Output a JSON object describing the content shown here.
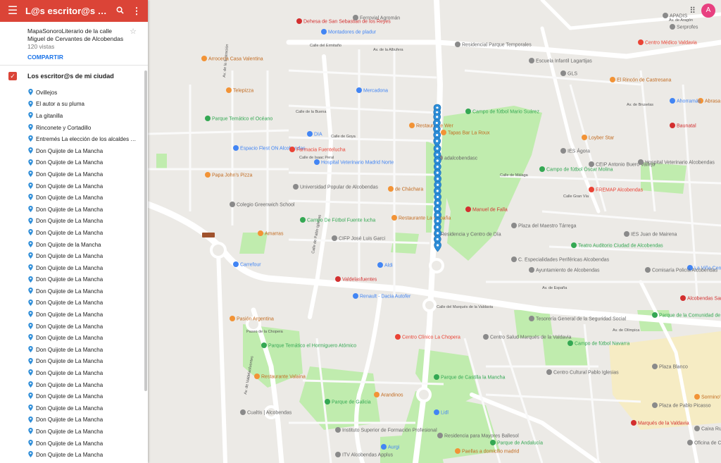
{
  "header": {
    "title": "L@s escritor@s de mi c...",
    "menu_icon": "menu-icon",
    "search_icon": "search-icon",
    "more_icon": "more-vert-icon"
  },
  "map_info": {
    "description": "MapaSonoroLiterario de la calle Miguel de Cervantes de Alcobendas",
    "views": "120 vistas",
    "share_label": "COMPARTIR"
  },
  "layer": {
    "name": "Los escritor@s de mi ciudad",
    "checked": true
  },
  "places": [
    "Ovillejos",
    "El autor a su pluma",
    "La gitanilla",
    "Rinconete y Cortadillo",
    "Entremés La elección de los alcaldes de ...",
    "Don Quijote de La Mancha",
    "Don Quijote de La Mancha",
    "Don Quijote de La Mancha",
    "Don Quijote de La Mancha",
    "Don Quijote de La Mancha",
    "Don Quijote de La Mancha",
    "Don Quijote de La Mancha",
    "Don Quijote de La Mancha",
    "Don Quijote de la Mancha",
    "Don Quijote de La Mancha",
    "Don Quijote de La Mancha",
    "Don Quijote de La Mancha",
    "Don Quijote de La Mancha",
    "Don Quijote de La Mancha",
    "Don Quijote de La Mancha",
    "Don Quijote de La Mancha",
    "Don Quijote de La Mancha",
    "Don Quijote de La Mancha",
    "Don Quijote de La Mancha",
    "Don Quijote de La Mancha",
    "Don Quijote de La Mancha",
    "Don Quijote de La Mancha",
    "Don Quijote de La Mancha",
    "Don Quijote de La Mancha",
    "Don Quijote de La Mancha",
    "Don Quijote de La Mancha",
    "Don Quijote de La Mancha"
  ],
  "account": {
    "avatar_letter": "A",
    "apps_icon": "apps-grid-icon"
  },
  "colors": {
    "header": "#db4437",
    "pin": "#2d8dd8",
    "water": "#aadaff",
    "park": "#c0ecae",
    "hospital": "#ea4335",
    "restaurant": "#f29336",
    "shop": "#4285f4",
    "park_poi": "#34a853",
    "metro": "#d32f2f",
    "pinkpoi": "#e04a82",
    "area": "#f6ecc4"
  },
  "map": {
    "streets": [
      "Av. de la Albufera",
      "Calle del Ermitaño",
      "Av. de la Ilustración",
      "Calle de Isaac Peral",
      "Calle de la Buena",
      "Calle de Goya",
      "Calle de Pablo Iglesias",
      "Calle de Málaga",
      "Av. de España",
      "Av. de Valdelasfuentes",
      "Calle del Marqués de la Valdavia",
      "Paseo de la Chopera",
      "Av. de Olímpica",
      "Av. de Aragón",
      "Calle Gran Vía",
      "Av. de Bruselas"
    ],
    "pois": [
      {
        "name": "Dehesa de San Sebastián de los Reyes",
        "kind": "metro"
      },
      {
        "name": "Ferrovial Agromán",
        "kind": "business"
      },
      {
        "name": "Montadores de pladur",
        "kind": "shop"
      },
      {
        "name": "Residencial Parque Temporales",
        "kind": "business"
      },
      {
        "name": "Arrocería Casa Valentina",
        "kind": "restaurant"
      },
      {
        "name": "Escuela Infantil Lagartijas",
        "kind": "business"
      },
      {
        "name": "GLS",
        "kind": "business"
      },
      {
        "name": "El Rincón de Castresana",
        "kind": "restaurant"
      },
      {
        "name": "Telepizza",
        "kind": "restaurant"
      },
      {
        "name": "Mercadona",
        "kind": "shop"
      },
      {
        "name": "Campo de fútbol Mario Suárez",
        "kind": "park"
      },
      {
        "name": "Parque Temático el Océano",
        "kind": "park"
      },
      {
        "name": "Restaurante Wer",
        "kind": "restaurant"
      },
      {
        "name": "Tapas Bar La Roux",
        "kind": "restaurant"
      },
      {
        "name": "DIA",
        "kind": "shop"
      },
      {
        "name": "Loyber Star",
        "kind": "restaurant"
      },
      {
        "name": "Espacio Flest ON Alcobendas",
        "kind": "shop"
      },
      {
        "name": "Farmacia Fuentelucha",
        "kind": "hospital"
      },
      {
        "name": "adalcobendasc",
        "kind": "business"
      },
      {
        "name": "IES Ágora",
        "kind": "business"
      },
      {
        "name": "Hospital Veterinario Madrid Norte",
        "kind": "shop"
      },
      {
        "name": "Papa John's Pizza",
        "kind": "restaurant"
      },
      {
        "name": "Campo de fútbol Óscar Molina",
        "kind": "park"
      },
      {
        "name": "CEIP Antonio Buero Vallejo",
        "kind": "business"
      },
      {
        "name": "Hospital Veterinario Alcobendas",
        "kind": "business"
      },
      {
        "name": "Universidad Popular de Alcobendas",
        "kind": "business"
      },
      {
        "name": "de Chácharа",
        "kind": "restaurant"
      },
      {
        "name": "FREMAP Alcobendas",
        "kind": "hospital"
      },
      {
        "name": "Colegio Greenwich School",
        "kind": "business"
      },
      {
        "name": "Campo De Fútbol Fuente lucha",
        "kind": "park"
      },
      {
        "name": "Restaurante La Cabaña",
        "kind": "restaurant"
      },
      {
        "name": "Manuel de Falla",
        "kind": "metro"
      },
      {
        "name": "Amarras",
        "kind": "restaurant"
      },
      {
        "name": "CIFP José Luis Garci",
        "kind": "business"
      },
      {
        "name": "Residencia y Centro de Día",
        "kind": "business"
      },
      {
        "name": "Plaza del Maestro Tárrega",
        "kind": "business"
      },
      {
        "name": "Teatro Auditorio Ciudad de Alcobendas",
        "kind": "park"
      },
      {
        "name": "IES Juan de Mairena",
        "kind": "business"
      },
      {
        "name": "Carrefour",
        "kind": "shop"
      },
      {
        "name": "Aldi",
        "kind": "shop"
      },
      {
        "name": "C. Especialidades Periféricas Alcobendas",
        "kind": "business"
      },
      {
        "name": "Ayuntamiento de Alcobendas",
        "kind": "business"
      },
      {
        "name": "La Viña Centro Comercial",
        "kind": "shop"
      },
      {
        "name": "Valdelasfuentes",
        "kind": "metro"
      },
      {
        "name": "Renault - Dacia Autofer",
        "kind": "shop"
      },
      {
        "name": "Comisaría Policía Alcobendas",
        "kind": "business"
      },
      {
        "name": "Alcobendas San Sebastián de los Reyes",
        "kind": "metro"
      },
      {
        "name": "Tesorería General de la Seguridad Social",
        "kind": "business"
      },
      {
        "name": "Parque de la Comunidad de Madrid",
        "kind": "park"
      },
      {
        "name": "Pasión Argentina",
        "kind": "restaurant"
      },
      {
        "name": "Centro Salud Marqués de la Valdavia",
        "kind": "business"
      },
      {
        "name": "Parque Temático el Hormiguero Atómico",
        "kind": "park"
      },
      {
        "name": "Centro Clínico La Chopera",
        "kind": "hospital"
      },
      {
        "name": "Campo de fútbol Navarra",
        "kind": "park"
      },
      {
        "name": "Restaurante Valaina",
        "kind": "restaurant"
      },
      {
        "name": "Parque de Castilla la Mancha",
        "kind": "park"
      },
      {
        "name": "Centro Cultural Pablo Iglesias",
        "kind": "business"
      },
      {
        "name": "Plaza Blanco",
        "kind": "business"
      },
      {
        "name": "Arandinos",
        "kind": "restaurant"
      },
      {
        "name": "Parque de Galicia",
        "kind": "park"
      },
      {
        "name": "Lidl",
        "kind": "shop"
      },
      {
        "name": "Cualtis | Alcobendas",
        "kind": "business"
      },
      {
        "name": "Instituto Superior de Formación Profesional",
        "kind": "business"
      },
      {
        "name": "Residencia para Mayores Ballesol",
        "kind": "business"
      },
      {
        "name": "Parque de Andalucía",
        "kind": "park"
      },
      {
        "name": "Plaza de Pablo Picasso",
        "kind": "business"
      },
      {
        "name": "Marqués de la Valdavia",
        "kind": "metro"
      },
      {
        "name": "Caixa Rural",
        "kind": "business"
      },
      {
        "name": "Oficina de Correos",
        "kind": "business"
      },
      {
        "name": "Sormino's Pizza",
        "kind": "restaurant"
      },
      {
        "name": "ITV Alcobendas Applus",
        "kind": "business"
      },
      {
        "name": "Aurgi",
        "kind": "shop"
      },
      {
        "name": "Paellas a domicilio madrid",
        "kind": "restaurant"
      },
      {
        "name": "Centro Médico Valdavia",
        "kind": "hospital"
      },
      {
        "name": "Abrasa",
        "kind": "restaurant"
      },
      {
        "name": "Serprofes",
        "kind": "business"
      },
      {
        "name": "APADIS",
        "kind": "business"
      },
      {
        "name": "Ahorramás",
        "kind": "shop"
      },
      {
        "name": "Baunatal",
        "kind": "metro"
      }
    ],
    "markers": [
      {
        "lat": 40.5479,
        "lng": -3.6415
      },
      {
        "lat": 40.5476,
        "lng": -3.6414
      },
      {
        "lat": 40.5473,
        "lng": -3.6414
      },
      {
        "lat": 40.5469,
        "lng": -3.6413
      },
      {
        "lat": 40.5465,
        "lng": -3.6413
      },
      {
        "lat": 40.5461,
        "lng": -3.6414
      },
      {
        "lat": 40.5457,
        "lng": -3.6414
      },
      {
        "lat": 40.5452,
        "lng": -3.6415
      },
      {
        "lat": 40.5448,
        "lng": -3.6415
      },
      {
        "lat": 40.5444,
        "lng": -3.6416
      },
      {
        "lat": 40.544,
        "lng": -3.6416
      },
      {
        "lat": 40.5436,
        "lng": -3.6416
      },
      {
        "lat": 40.5432,
        "lng": -3.6417
      },
      {
        "lat": 40.5428,
        "lng": -3.6417
      },
      {
        "lat": 40.5424,
        "lng": -3.6416
      },
      {
        "lat": 40.542,
        "lng": -3.6417
      },
      {
        "lat": 40.5416,
        "lng": -3.6417
      },
      {
        "lat": 40.5412,
        "lng": -3.6416
      },
      {
        "lat": 40.5408,
        "lng": -3.6417
      },
      {
        "lat": 40.5404,
        "lng": -3.6417
      },
      {
        "lat": 40.54,
        "lng": -3.6416
      },
      {
        "lat": 40.5396,
        "lng": -3.6417
      },
      {
        "lat": 40.5392,
        "lng": -3.6416
      },
      {
        "lat": 40.5388,
        "lng": -3.6417
      }
    ]
  }
}
